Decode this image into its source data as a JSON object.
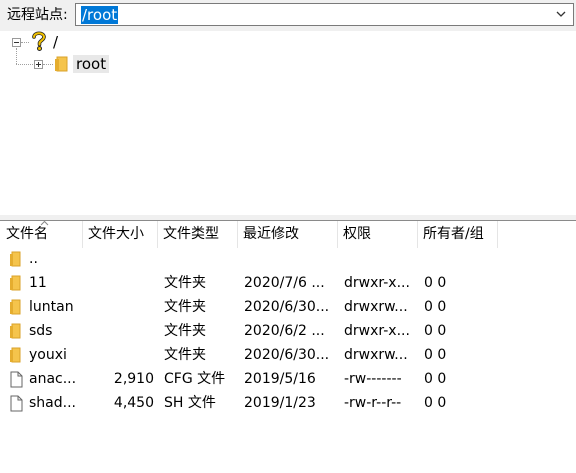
{
  "remote_site": {
    "label": "远程站点:",
    "path": "/root"
  },
  "tree": {
    "root_label": "/",
    "child_label": "root"
  },
  "list": {
    "columns": [
      "文件名",
      "文件大小",
      "文件类型",
      "最近修改",
      "权限",
      "所有者/组"
    ],
    "rows": [
      {
        "name": "..",
        "size": "",
        "type": "",
        "modified": "",
        "perms": "",
        "owner": "",
        "icon": "folder-icon"
      },
      {
        "name": "11",
        "size": "",
        "type": "文件夹",
        "modified": "2020/7/6 ...",
        "perms": "drwxr-x...",
        "owner": "0 0",
        "icon": "folder-icon"
      },
      {
        "name": "luntan",
        "size": "",
        "type": "文件夹",
        "modified": "2020/6/30...",
        "perms": "drwxrw...",
        "owner": "0 0",
        "icon": "folder-icon"
      },
      {
        "name": "sds",
        "size": "",
        "type": "文件夹",
        "modified": "2020/6/2 ...",
        "perms": "drwxr-x...",
        "owner": "0 0",
        "icon": "folder-icon"
      },
      {
        "name": "youxi",
        "size": "",
        "type": "文件夹",
        "modified": "2020/6/30...",
        "perms": "drwxrw...",
        "owner": "0 0",
        "icon": "folder-icon"
      },
      {
        "name": "anac...",
        "size": "2,910",
        "type": "CFG 文件",
        "modified": "2019/5/16",
        "perms": "-rw-------",
        "owner": "0 0",
        "icon": "file-icon"
      },
      {
        "name": "shad...",
        "size": "4,450",
        "type": "SH 文件",
        "modified": "2019/1/23",
        "perms": "-rw-r--r--",
        "owner": "0 0",
        "icon": "file-icon"
      }
    ]
  },
  "colors": {
    "selection": "#0078d7",
    "folder": "#f5c44c",
    "folder_dark": "#d9a22a",
    "unknown_icon": "#e8b400"
  }
}
